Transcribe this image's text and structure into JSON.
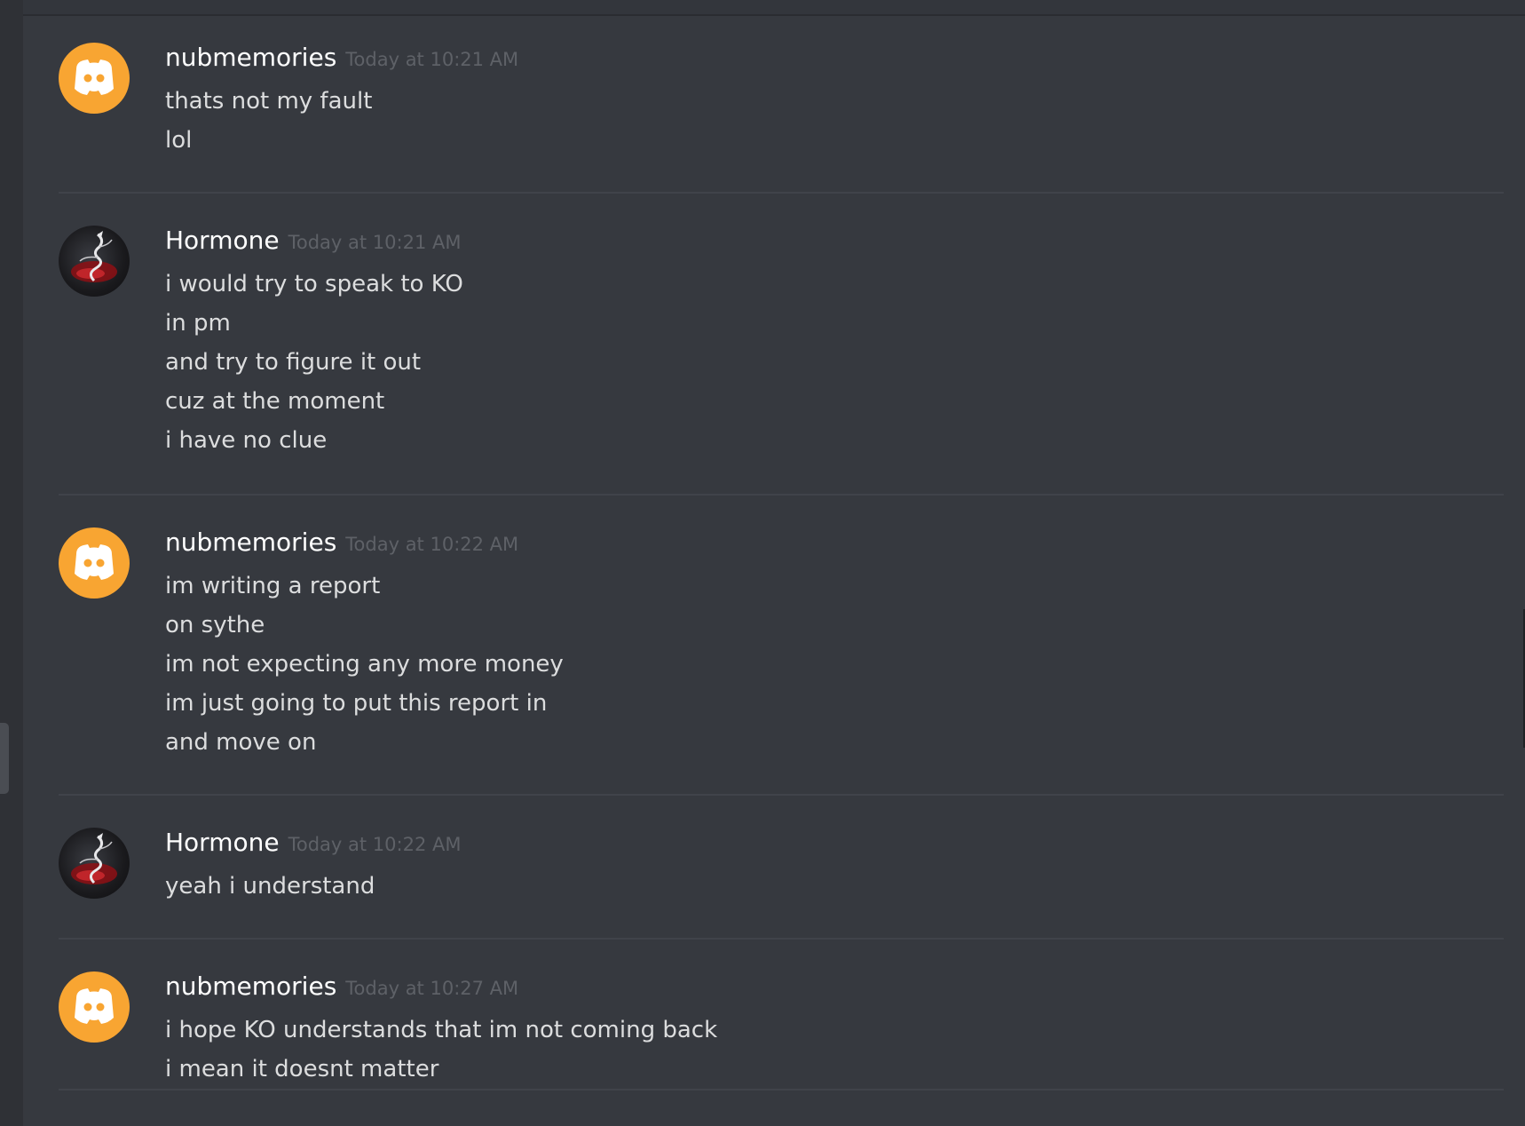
{
  "colors": {
    "background": "#36393f",
    "username": "#ffffff",
    "timestamp": "#5e6167",
    "message_text": "#dcddde",
    "default_avatar_orange": "#f8a532",
    "divider": "#40434a"
  },
  "icons": {
    "default_avatar": "discord-logo-icon",
    "user_avatar": "red-dragon-avatar"
  },
  "messages": [
    {
      "username": "nubmemories",
      "timestamp": "Today at 10:21 AM",
      "avatar": "default-orange",
      "lines": [
        "thats not my fault",
        "lol"
      ]
    },
    {
      "username": "Hormone",
      "timestamp": "Today at 10:21 AM",
      "avatar": "dragon",
      "lines": [
        "i would try to speak to KO",
        "in pm",
        "and try to figure it out",
        "cuz at the moment",
        "i have no clue"
      ]
    },
    {
      "username": "nubmemories",
      "timestamp": "Today at 10:22 AM",
      "avatar": "default-orange",
      "lines": [
        "im writing a report",
        "on sythe",
        "im not expecting any more money",
        "im just going to put this report in",
        "and move on"
      ]
    },
    {
      "username": "Hormone",
      "timestamp": "Today at 10:22 AM",
      "avatar": "dragon",
      "lines": [
        "yeah i understand"
      ]
    },
    {
      "username": "nubmemories",
      "timestamp": "Today at 10:27 AM",
      "avatar": "default-orange",
      "lines": [
        "i hope KO understands that im not coming back",
        "i mean it doesnt matter"
      ]
    }
  ]
}
